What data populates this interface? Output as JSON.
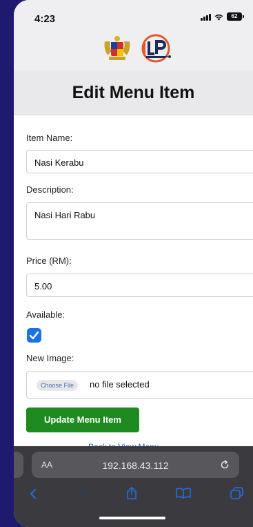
{
  "status_bar": {
    "time": "4:23",
    "battery": "62"
  },
  "header": {
    "title": "Edit Menu Item"
  },
  "form": {
    "item_name_label": "Item Name:",
    "item_name_value": "Nasi Kerabu",
    "description_label": "Description:",
    "description_value": "Nasi Hari Rabu",
    "price_label": "Price (RM):",
    "price_value": "5.00",
    "available_label": "Available:",
    "available_checked": true,
    "new_image_label": "New Image:",
    "choose_file_label": "Choose File",
    "no_file_text": "no file selected",
    "submit_label": "Update Menu Item",
    "back_link_partial": "Back to View Menu"
  },
  "browser": {
    "aa_label": "AA",
    "url": "192.168.43.112"
  },
  "colors": {
    "accent_green": "#1f8a1f",
    "checkbox_blue": "#1a73e8",
    "toolbar_blue": "#1f6fe5",
    "background_navy": "#1e1b6e"
  },
  "icons": {
    "status": [
      "signal-icon",
      "wifi-icon",
      "battery-icon"
    ],
    "browser": [
      "reload-icon",
      "back-icon",
      "forward-icon",
      "share-icon",
      "bookmarks-icon",
      "tabs-icon"
    ]
  }
}
